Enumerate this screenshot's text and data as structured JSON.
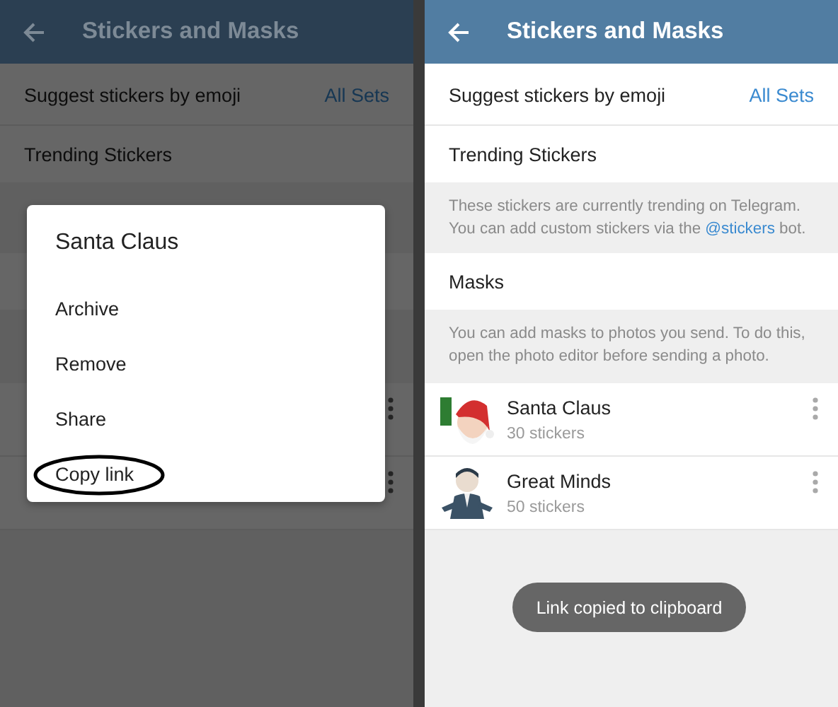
{
  "left_screen": {
    "title": "Stickers and Masks",
    "rows": [
      {
        "label": "Suggest stickers by emoji",
        "value": "All Sets"
      },
      {
        "label": "Trending Stickers"
      }
    ],
    "dialog": {
      "title": "Santa Claus",
      "items": [
        {
          "label": "Archive",
          "circled": false
        },
        {
          "label": "Remove",
          "circled": false
        },
        {
          "label": "Share",
          "circled": false
        },
        {
          "label": "Copy link",
          "circled": true
        }
      ]
    }
  },
  "right_screen": {
    "title": "Stickers and Masks",
    "suggest": {
      "label": "Suggest stickers by emoji",
      "value": "All Sets"
    },
    "trending": {
      "label": "Trending Stickers"
    },
    "trending_hint": {
      "before": "These stickers are currently trending on Telegram. You can add custom stickers via the",
      "link": "@stickers",
      "after": "bot."
    },
    "masks": {
      "label": "Masks"
    },
    "masks_hint": "You can add masks to photos you send. To do this, open the photo editor before sending a photo.",
    "sticker_sets": [
      {
        "name": "Santa Claus",
        "count": "30 stickers"
      },
      {
        "name": "Great Minds",
        "count": "50 stickers"
      }
    ],
    "toast": "Link copied to clipboard"
  }
}
